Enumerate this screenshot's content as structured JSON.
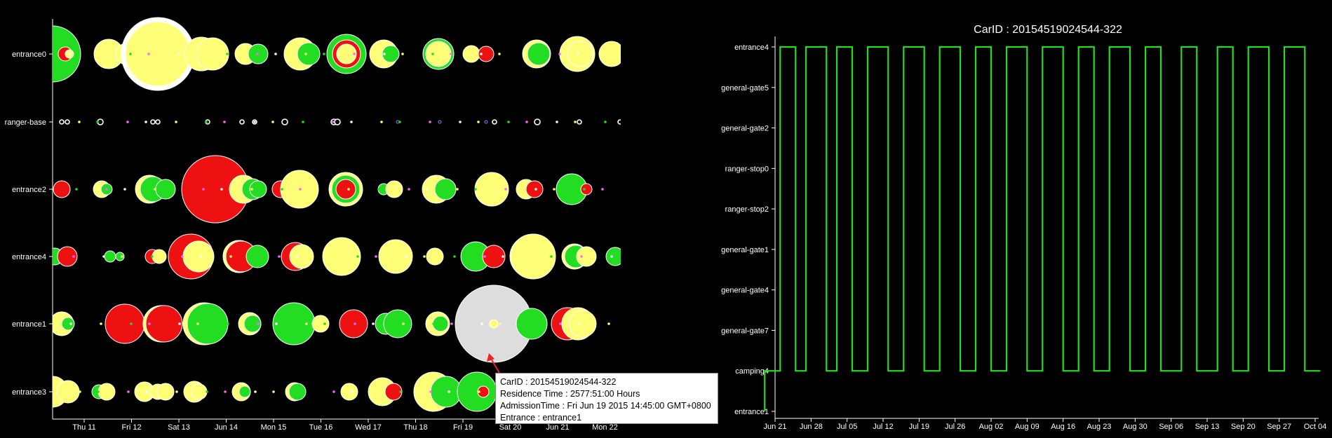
{
  "tooltip": {
    "car_id": "CarID : 20154519024544-322",
    "residence": "Residence Time : 2577:51:00 Hours",
    "admission": "AdmissionTime : Fri Jun 19 2015 14:45:00 GMT+0800",
    "entrance": "Entrance : entrance1"
  },
  "chart_data": [
    {
      "type": "scatter",
      "title": "",
      "rows": [
        "entrance0",
        "ranger-base",
        "entrance2",
        "entrance4",
        "entrance1",
        "entrance3"
      ],
      "x_ticks": [
        "Thu 11",
        "Fri 12",
        "Sat 13",
        "Jun 14",
        "Mon 15",
        "Tue 16",
        "Wed 17",
        "Thu 18",
        "Fri 19",
        "Sat 20",
        "Jun 21",
        "Mon 22"
      ],
      "colors": {
        "yellow": "#ffff77",
        "green": "#22dd22",
        "red": "#ee1111",
        "highlight": "#dddddd"
      },
      "encoding": "bubble size = residence time; color = vehicle type",
      "highlighted": {
        "row": "entrance1",
        "x": "Fri 19 14:45"
      }
    },
    {
      "type": "line",
      "title": "CarID : 20154519024544-322",
      "y_categories": [
        "entrance4",
        "general-gate5",
        "general-gate2",
        "ranger-stop0",
        "ranger-stop2",
        "general-gate1",
        "general-gate4",
        "general-gate7",
        "camping4",
        "entrance1"
      ],
      "x_ticks": [
        "Jun 21",
        "Jun 28",
        "Jul 05",
        "Jul 12",
        "Jul 19",
        "Jul 26",
        "Aug 02",
        "Aug 09",
        "Aug 16",
        "Aug 23",
        "Aug 30",
        "Sep 06",
        "Sep 13",
        "Sep 20",
        "Sep 27",
        "Oct 04"
      ],
      "line_color": "#22dd22",
      "series": [
        {
          "x": [
            "Jun 19",
            "Jun 19",
            "Jun 20",
            "Jun 22",
            "Jun 22",
            "Jun 25",
            "Jun 25",
            "Jun 27",
            "Jun 27",
            "Jul 01",
            "Jul 01",
            "Jul 03",
            "Jul 03",
            "Jul 06",
            "Jul 06",
            "Jul 09",
            "Jul 09",
            "Jul 13",
            "Jul 13",
            "Jul 16",
            "Jul 16",
            "Jul 20",
            "Jul 20",
            "Jul 23",
            "Jul 23",
            "Jul 27",
            "Jul 27",
            "Jul 30",
            "Jul 30",
            "Aug 02",
            "Aug 02",
            "Aug 05",
            "Aug 05",
            "Aug 09",
            "Aug 09",
            "Aug 12",
            "Aug 12",
            "Aug 16",
            "Aug 16",
            "Aug 19",
            "Aug 19",
            "Aug 22",
            "Aug 22",
            "Aug 25",
            "Aug 25",
            "Aug 29",
            "Aug 29",
            "Sep 01",
            "Sep 01",
            "Sep 04",
            "Sep 04",
            "Sep 08",
            "Sep 08",
            "Sep 11",
            "Sep 11",
            "Sep 15",
            "Sep 15",
            "Sep 18",
            "Sep 18",
            "Sep 21",
            "Sep 21",
            "Sep 25",
            "Sep 25",
            "Sep 28",
            "Sep 28",
            "Oct 02",
            "Oct 02",
            "Oct 05"
          ],
          "y": [
            "entrance1",
            "camping4",
            "camping4",
            "camping4",
            "entrance4",
            "entrance4",
            "camping4",
            "camping4",
            "entrance4",
            "entrance4",
            "camping4",
            "camping4",
            "entrance4",
            "entrance4",
            "camping4",
            "camping4",
            "entrance4",
            "entrance4",
            "camping4",
            "camping4",
            "entrance4",
            "entrance4",
            "camping4",
            "camping4",
            "entrance4",
            "entrance4",
            "camping4",
            "camping4",
            "entrance4",
            "entrance4",
            "camping4",
            "camping4",
            "entrance4",
            "entrance4",
            "camping4",
            "camping4",
            "entrance4",
            "entrance4",
            "camping4",
            "camping4",
            "entrance4",
            "entrance4",
            "camping4",
            "camping4",
            "entrance4",
            "entrance4",
            "camping4",
            "camping4",
            "entrance4",
            "entrance4",
            "camping4",
            "camping4",
            "entrance4",
            "entrance4",
            "camping4",
            "camping4",
            "entrance4",
            "entrance4",
            "camping4",
            "camping4",
            "entrance4",
            "entrance4",
            "camping4",
            "camping4",
            "entrance4",
            "entrance4",
            "camping4",
            "camping4"
          ]
        }
      ]
    }
  ]
}
